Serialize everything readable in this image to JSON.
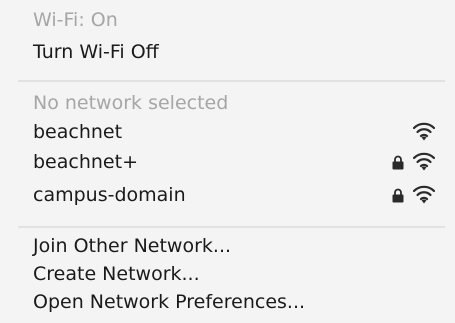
{
  "menu": {
    "wifi_status": "Wi-Fi: On",
    "toggle_wifi": "Turn Wi-Fi Off",
    "network_status": "No network selected",
    "networks": [
      {
        "name": "beachnet",
        "secured": false,
        "signal_icon": "wifi-signal-icon"
      },
      {
        "name": "beachnet+",
        "secured": true,
        "lock_icon": "lock-icon",
        "signal_icon": "wifi-signal-icon"
      },
      {
        "name": "campus-domain",
        "secured": true,
        "lock_icon": "lock-icon",
        "signal_icon": "wifi-signal-icon"
      }
    ],
    "join_other": "Join Other Network...",
    "create_network": "Create Network...",
    "open_preferences": "Open Network Preferences..."
  },
  "colors": {
    "background": "#f4f4f4",
    "text": "#1a1a1a",
    "disabled_text": "#a6a6a6",
    "separator": "#e2e2e2"
  }
}
